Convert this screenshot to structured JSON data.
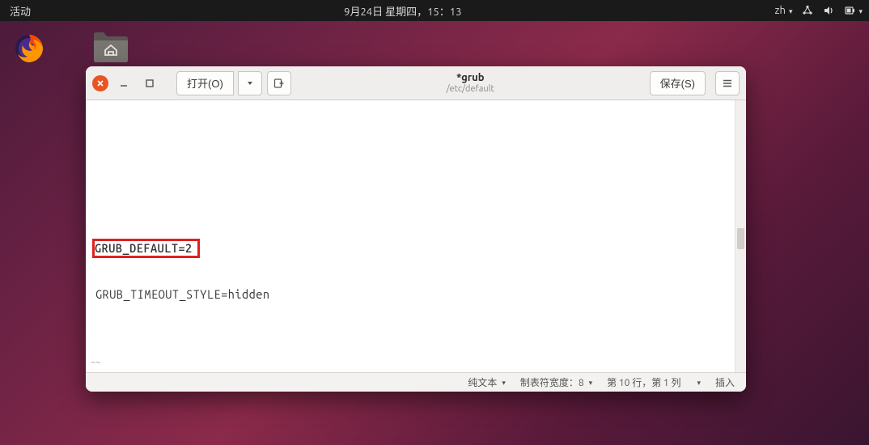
{
  "topbar": {
    "activities": "活动",
    "datetime": "9月24日 星期四，15：13",
    "input_method": "zh"
  },
  "window": {
    "open_label": "打开(O)",
    "save_label": "保存(S)",
    "filename": "*grub",
    "filepath": "/etc/default"
  },
  "editor": {
    "line1": "GRUB_DEFAULT=2",
    "line2": "GRUB_TIMEOUT_STYLE=hidden"
  },
  "statusbar": {
    "syntax": "纯文本",
    "tab_label": "制表符宽度：8",
    "position": "第 10 行，第 1 列",
    "insert_mode": "插入"
  }
}
